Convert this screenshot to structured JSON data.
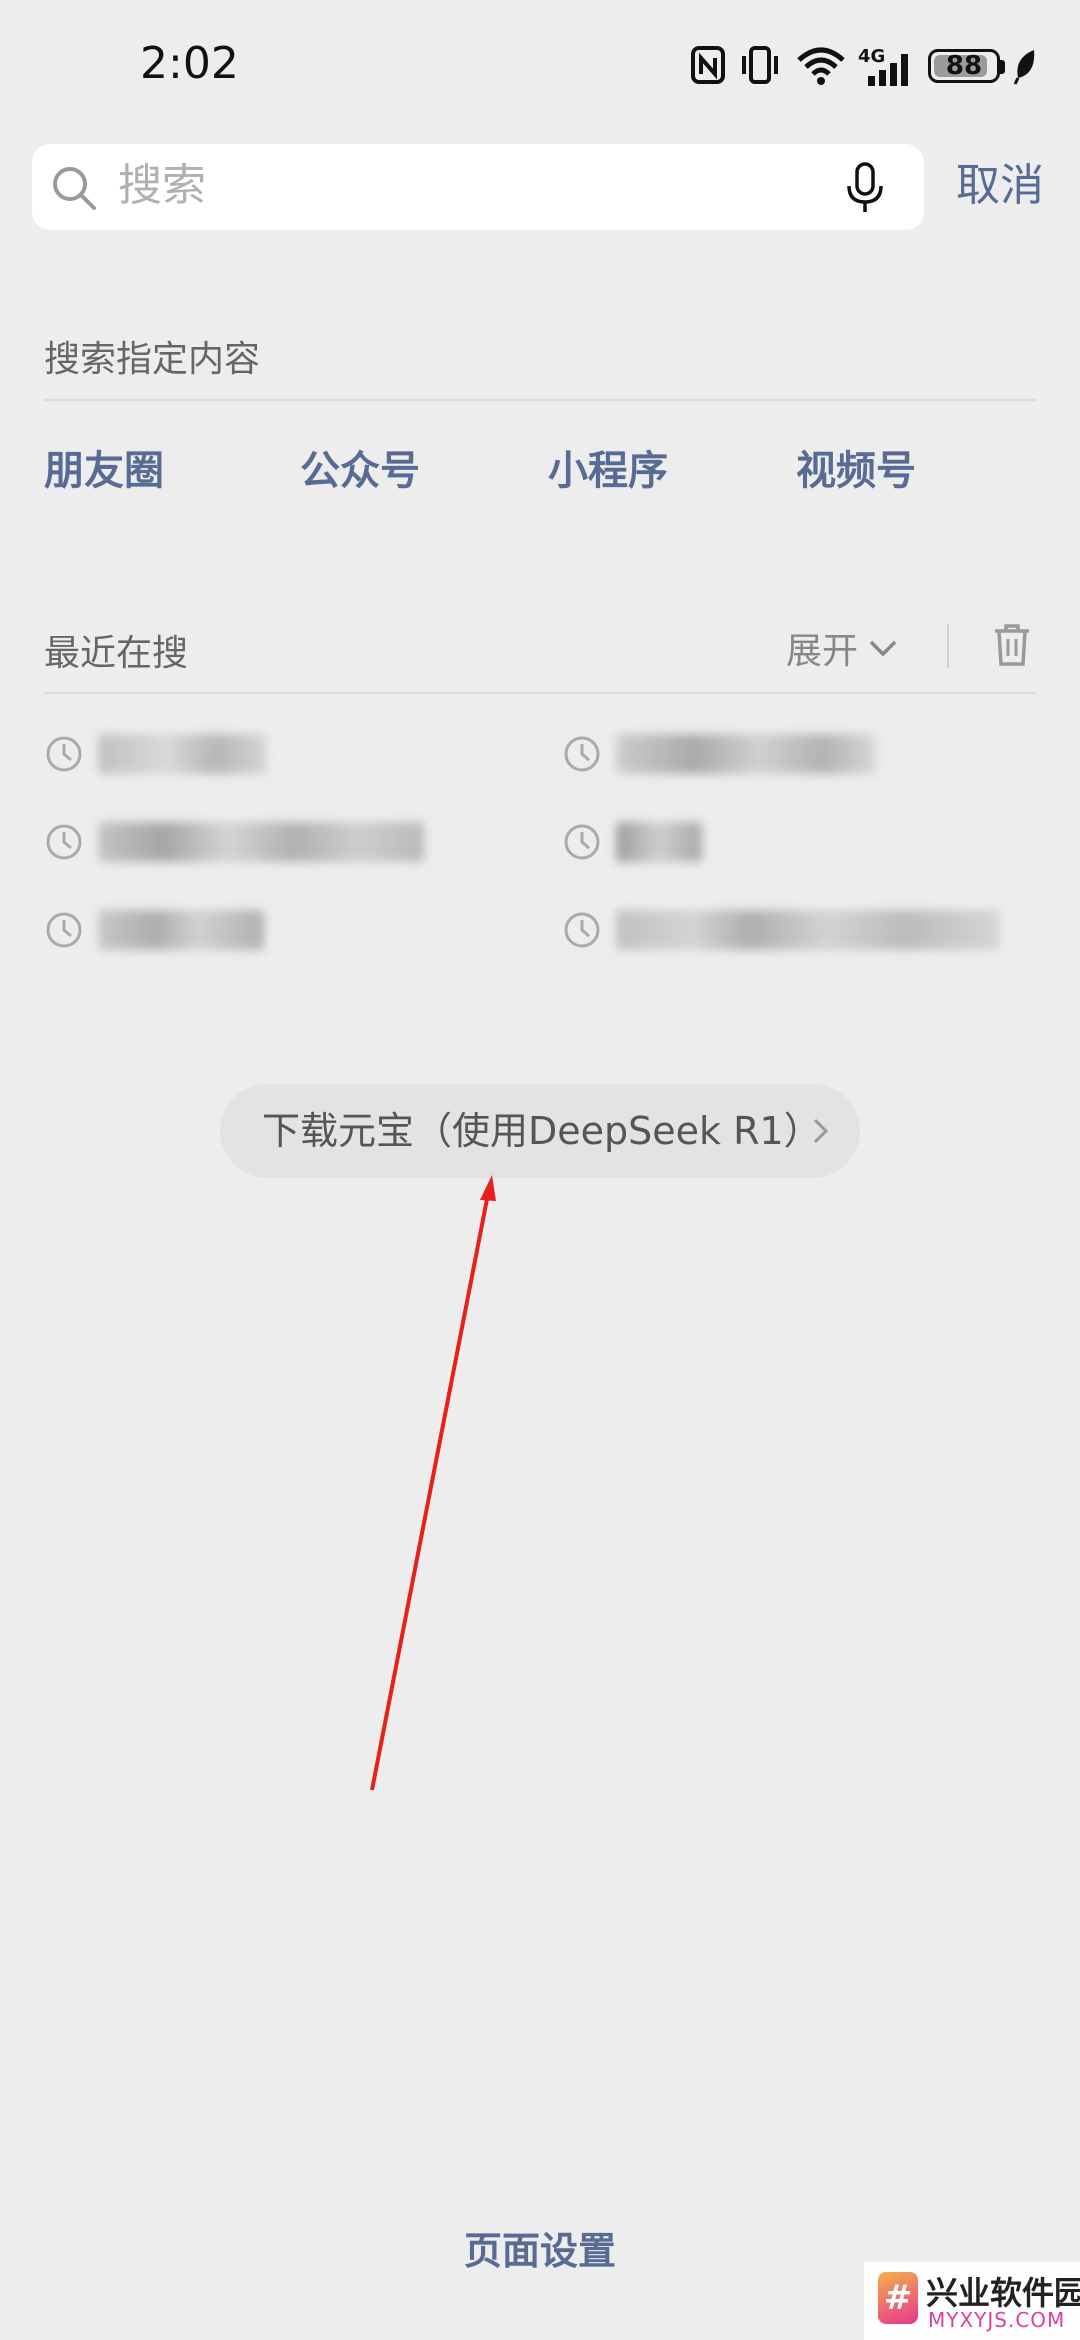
{
  "status_bar": {
    "time": "2:02",
    "network": "4G",
    "battery": "88",
    "battery_level": 0.88
  },
  "search": {
    "placeholder": "搜索",
    "cancel_label": "取消"
  },
  "specified": {
    "title": "搜索指定内容",
    "categories": [
      "朋友圈",
      "公众号",
      "小程序",
      "视频号"
    ]
  },
  "recent": {
    "title": "最近在搜",
    "expand_label": "展开",
    "items_note": "recent search terms are blurred/pixelated in the original"
  },
  "promo": {
    "label": "下载元宝（使用DeepSeek R1）"
  },
  "footer": {
    "page_settings": "页面设置"
  },
  "watermark": {
    "cn": "兴业软件园",
    "en": "MYXYJS.COM"
  },
  "colors": {
    "accent": "#576b95",
    "background": "#ededed",
    "annotation_arrow": "#e8201a"
  }
}
